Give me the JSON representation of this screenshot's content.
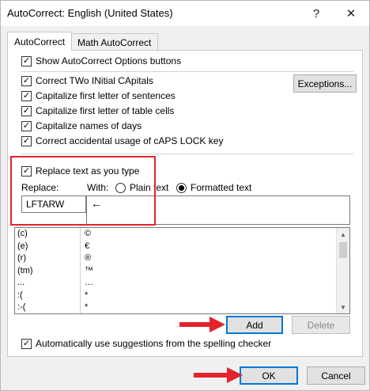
{
  "window": {
    "title": "AutoCorrect: English (United States)",
    "help_glyph": "?",
    "close_glyph": "✕"
  },
  "tabs": [
    {
      "label": "AutoCorrect",
      "active": true
    },
    {
      "label": "Math AutoCorrect",
      "active": false
    }
  ],
  "options": {
    "show_buttons": "Show AutoCorrect Options buttons",
    "two_initial": "Correct TWo INitial CApitals",
    "first_sentence": "Capitalize first letter of sentences",
    "first_table": "Capitalize first letter of table cells",
    "days": "Capitalize names of days",
    "caps_lock": "Correct accidental usage of cAPS LOCK key",
    "exceptions_label": "Exceptions..."
  },
  "replace_section": {
    "replace_as_type": "Replace text as you type",
    "replace_label": "Replace:",
    "with_label": "With:",
    "plain_text": "Plain text",
    "formatted_text": "Formatted text",
    "selected_format": "formatted",
    "replace_value": "LFTARW",
    "with_value": "←"
  },
  "entries": [
    {
      "from": "(c)",
      "to": "©"
    },
    {
      "from": "(e)",
      "to": "€"
    },
    {
      "from": "(r)",
      "to": "®"
    },
    {
      "from": "(tm)",
      "to": "™"
    },
    {
      "from": "...",
      "to": "…"
    },
    {
      "from": ":(",
      "to": "*"
    },
    {
      "from": ":-(",
      "to": "*"
    }
  ],
  "buttons": {
    "add": "Add",
    "delete": "Delete",
    "ok": "OK",
    "cancel": "Cancel"
  },
  "suggestions": "Automatically use suggestions from the spelling checker",
  "colors": {
    "accent": "#0078d7",
    "annotation_red": "#e3242b"
  }
}
